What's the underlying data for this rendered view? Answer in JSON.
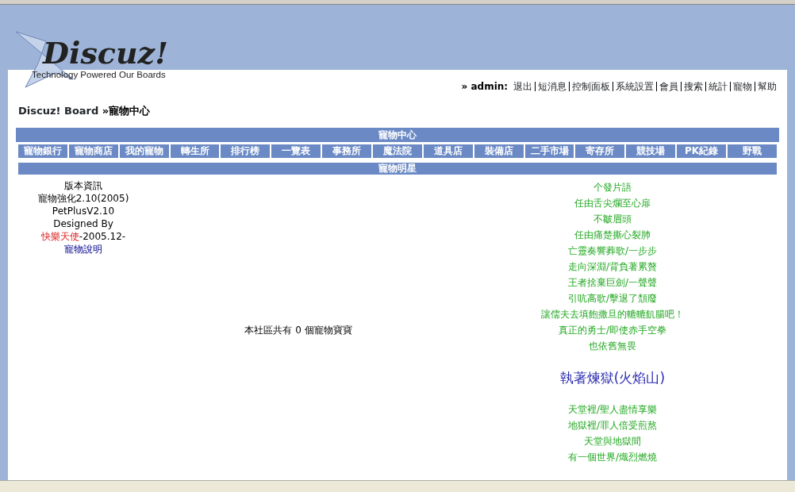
{
  "logo": {
    "name": "Discuz!",
    "tagline": "Technology Powered Our Boards"
  },
  "header": {
    "user": "» admin:",
    "links": [
      "退出",
      "短消息",
      "控制面板",
      "系統設置",
      "會員",
      "搜索",
      "統計",
      "寵物",
      "幫助"
    ]
  },
  "breadcrumb": {
    "home": "Discuz! Board",
    "separator": "»",
    "current": "寵物中心"
  },
  "panel_title": "寵物中心",
  "nav": [
    "寵物銀行",
    "寵物商店",
    "我的寵物",
    "轉生所",
    "排行榜",
    "一覽表",
    "事務所",
    "魔法院",
    "道具店",
    "裝備店",
    "二手市場",
    "寄存所",
    "競技場",
    "PK紀錄",
    "野戰"
  ],
  "section_title": "寵物明星",
  "info": [
    {
      "kind": "text",
      "text": "版本資訊"
    },
    {
      "kind": "text",
      "text": "寵物強化2.10(2005)"
    },
    {
      "kind": "text",
      "text": "PetPlusV2.10"
    },
    {
      "kind": "text",
      "text": "Designed By"
    },
    {
      "kind": "credit",
      "author": "快樂天使",
      "date": "-2005.12-"
    },
    {
      "kind": "link",
      "text": "寵物說明"
    }
  ],
  "pet_count": "本社區共有 0 個寵物寶寶",
  "poem": [
    {
      "kind": "line",
      "text": "个發片語"
    },
    {
      "kind": "line",
      "text": "任由舌尖爛至心扉"
    },
    {
      "kind": "line",
      "text": "不皺眉頭"
    },
    {
      "kind": "line",
      "text": "任由痛楚撕心裂肺"
    },
    {
      "kind": "line",
      "text": "亡靈奏響葬歌/一步步"
    },
    {
      "kind": "line",
      "text": "走向深淵/背負著累贅"
    },
    {
      "kind": "line",
      "text": "王者捨棄巨劍/一聲聲"
    },
    {
      "kind": "line",
      "text": "引吭高歌/擊退了頹廢"
    },
    {
      "kind": "line",
      "text": "讓儒夫去填飽撒旦的轆轆飢腸吧！"
    },
    {
      "kind": "line",
      "text": "真正的勇士/即使赤手空拳"
    },
    {
      "kind": "line",
      "text": "也依舊無畏"
    },
    {
      "kind": "title",
      "text": "執著煉獄(火焰山)"
    },
    {
      "kind": "line",
      "text": "天堂裡/聖人盡情享樂"
    },
    {
      "kind": "line",
      "text": "地獄裡/罪人倍受煎熬"
    },
    {
      "kind": "line",
      "text": "天堂與地獄間"
    },
    {
      "kind": "line",
      "text": "有一個世界/熾烈燃燒"
    }
  ]
}
